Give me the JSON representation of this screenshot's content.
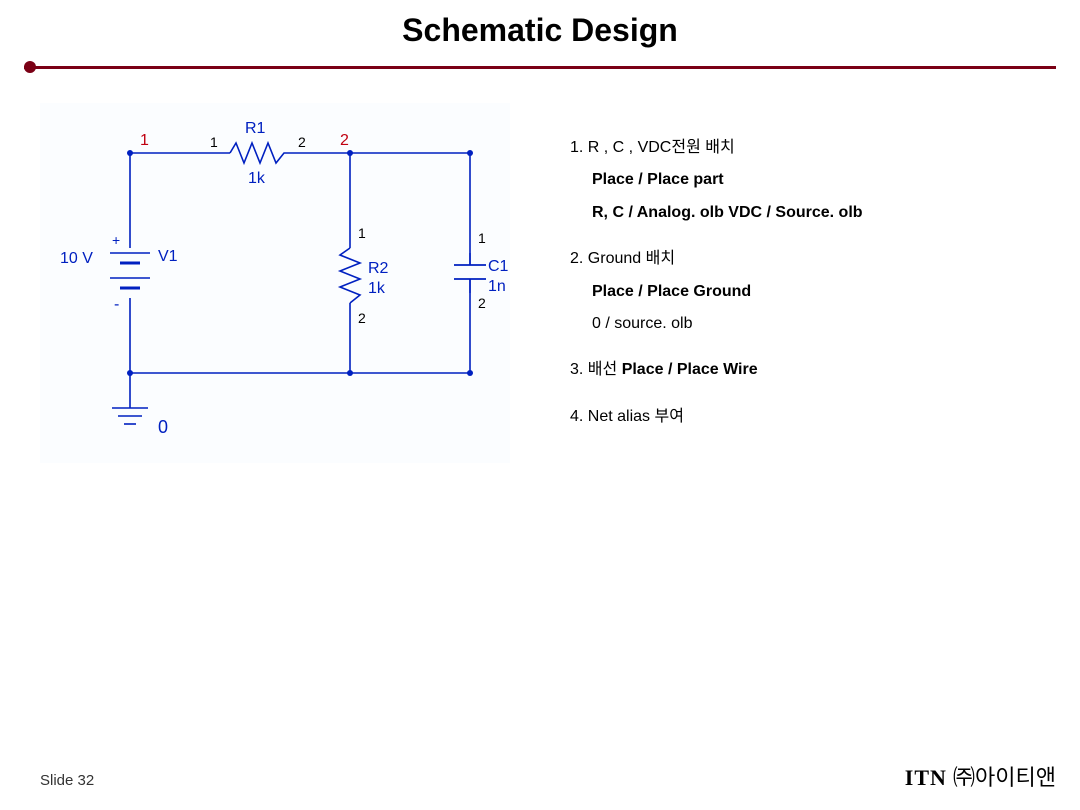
{
  "title": "Schematic Design",
  "schematic": {
    "nets": {
      "node1": "1",
      "node2": "2",
      "ground": "0"
    },
    "pins": {
      "p1": "1",
      "p2": "2"
    },
    "v1": {
      "ref": "V1",
      "value": "10 V"
    },
    "r1": {
      "ref": "R1",
      "value": "1k"
    },
    "r2": {
      "ref": "R2",
      "value": "1k"
    },
    "c1": {
      "ref": "C1",
      "value": "1n"
    }
  },
  "instructions": {
    "i1": {
      "head": "1.  R , C , VDC전원 배치",
      "s1label": "Place / Place part",
      "s2": "R, C / Analog. olb  VDC / Source. olb"
    },
    "i2": {
      "head": "2. Ground 배치",
      "s1label": "Place / Place Ground",
      "s2": "0 / source. olb"
    },
    "i3": {
      "head_pre": "3. 배선 ",
      "head_b": "Place / Place Wire"
    },
    "i4": {
      "head": "4. Net alias 부여"
    }
  },
  "footer": {
    "slide": "Slide 32",
    "brand_itn": "ITN",
    "brand_hangul": " ㈜아이티앤"
  }
}
